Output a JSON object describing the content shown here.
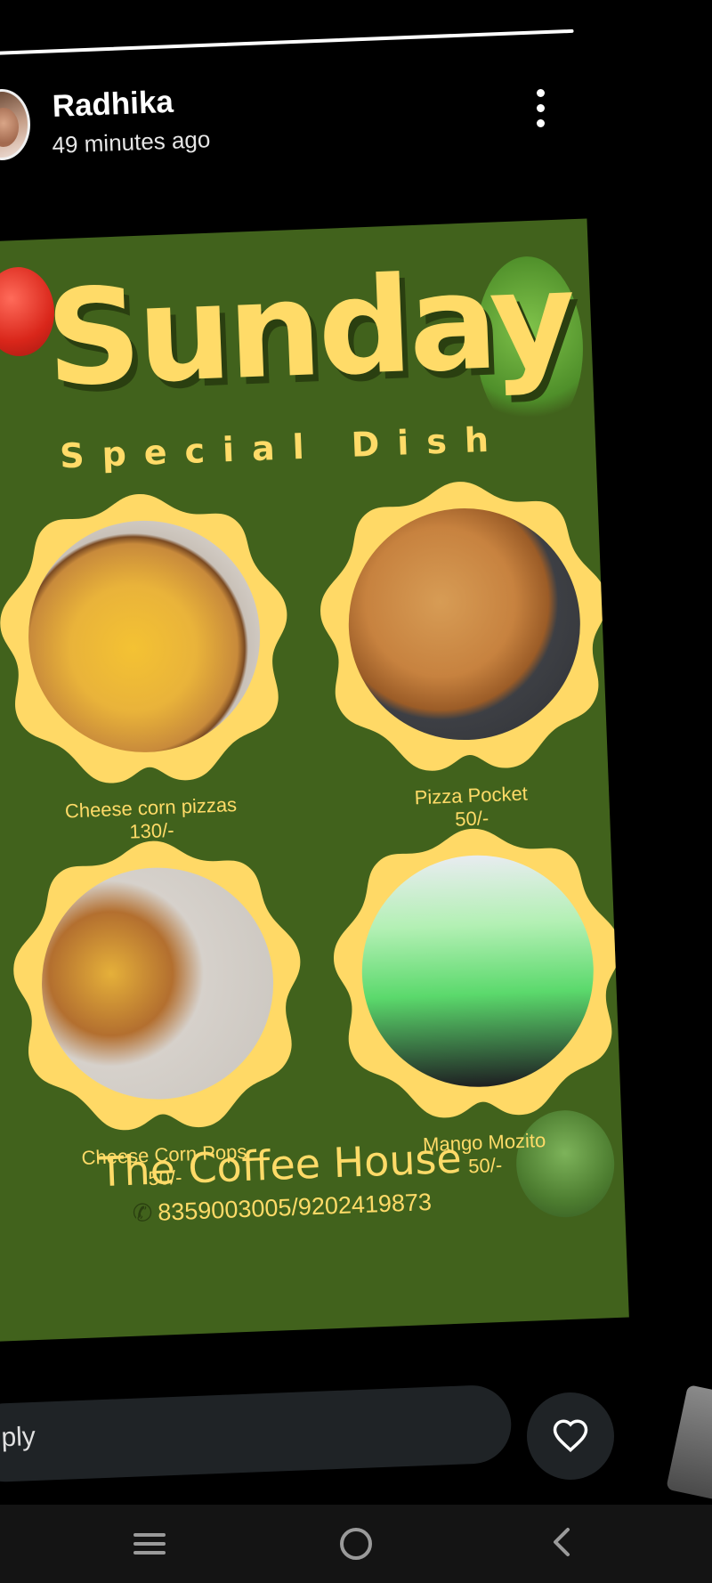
{
  "header": {
    "user_name": "Radhika",
    "post_time": "49 minutes ago",
    "more_icon": "more-vertical-icon",
    "avatar_icon": "profile-avatar"
  },
  "story": {
    "title": "Sunday",
    "subtitle": "Special Dish",
    "dishes": [
      {
        "name": "Cheese corn pizzas",
        "price": "130/-"
      },
      {
        "name": "Pizza Pocket",
        "price": "50/-"
      },
      {
        "name": "Cheese Corn Pops",
        "price": "50/-"
      },
      {
        "name": "Mango Mozito",
        "price": "50/-"
      }
    ],
    "brand": "The Coffee House",
    "phone": "8359003005/9202419873"
  },
  "reply": {
    "placeholder": "ply",
    "like_icon": "heart-icon"
  },
  "nav": {
    "menu_icon": "recents-icon",
    "home_icon": "home-icon",
    "back_icon": "back-icon"
  },
  "colors": {
    "card_bg": "#41621c",
    "accent_yellow": "#ffdb68",
    "reply_bg": "#1f2326",
    "nav_bg": "#141414"
  }
}
